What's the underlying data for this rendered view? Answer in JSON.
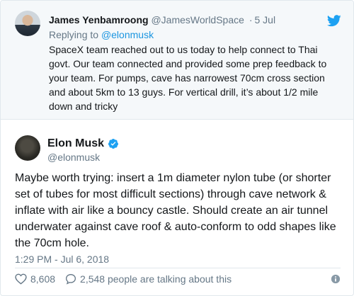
{
  "parent_tweet": {
    "name": "James Yenbamroong",
    "handle": "@JamesWorldSpace",
    "separator": "·",
    "date": "5 Jul",
    "replying_prefix": "Replying to",
    "replying_to": "@elonmusk",
    "text": "SpaceX team reached out to us today to help connect to Thai govt.  Our team connected and provided some prep feedback to your team.  For pumps, cave has narrowest 70cm cross section and about 5km to 13 guys.  For vertical drill, it’s about 1/2 mile down and tricky"
  },
  "main_tweet": {
    "name": "Elon Musk",
    "handle": "@elonmusk",
    "text": "Maybe worth trying: insert a 1m diameter nylon tube (or shorter set of tubes for most difficult sections) through cave network & inflate with air like a bouncy castle. Should create an air tunnel underwater against cave roof & auto-conform to odd shapes like the 70cm hole.",
    "timestamp": "1:29 PM - Jul 6, 2018",
    "likes": "8,608",
    "talking": "2,548 people are talking about this"
  },
  "icons": {
    "brand": "twitter-bird-icon",
    "verified": "verified-badge-icon",
    "like": "heart-icon",
    "reply": "speech-bubble-icon",
    "info": "info-icon"
  },
  "colors": {
    "accent": "#1da1f2",
    "link": "#1b95e0",
    "muted": "#657786",
    "text": "#14171a",
    "parent_bg": "#f5f8fa",
    "border": "#e1e8ed"
  }
}
